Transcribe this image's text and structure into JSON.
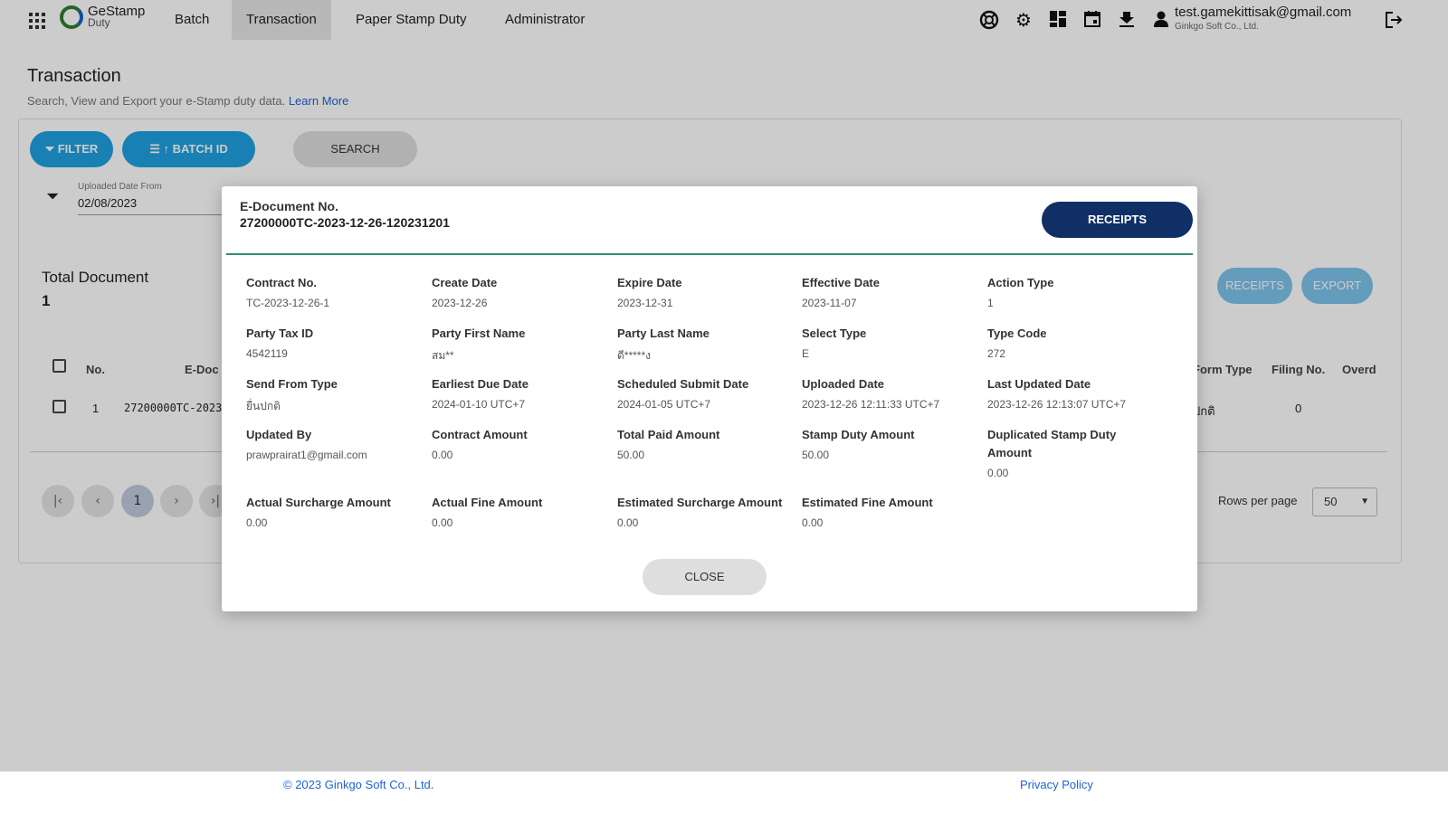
{
  "nav": {
    "logo_line1": "GeStamp",
    "logo_line2": "Duty",
    "items": [
      "Batch",
      "Transaction",
      "Paper Stamp Duty",
      "Administrator"
    ],
    "user_email": "test.gamekittisak@gmail.com",
    "user_company": "Ginkgo Soft Co., Ltd."
  },
  "page": {
    "title": "Transaction",
    "subtitle": "Search, View and Export your e-Stamp duty data.",
    "learn_more": "Learn More"
  },
  "toolbar": {
    "filter_label": "FILTER",
    "batch_id_label": "BATCH ID",
    "search_label": "SEARCH"
  },
  "filters": {
    "uploaded_from_label": "Uploaded Date From",
    "uploaded_from_value": "02/08/2023"
  },
  "summary": {
    "total_label": "Total Document",
    "total_value": "1",
    "receipts_label": "RECEIPTS",
    "export_label": "EXPORT"
  },
  "table": {
    "headers": {
      "no": "No.",
      "edoc": "E-Doc",
      "form_type": "Form Type",
      "filing_no": "Filing No.",
      "overdue": "Overd"
    },
    "row": {
      "no": "1",
      "edoc": "27200000TC-2023",
      "form_type": "ปกติ",
      "filing_no": "0"
    }
  },
  "pager": {
    "current_page": "1",
    "rows_per_page_label": "Rows per page",
    "rows_per_page_value": "50"
  },
  "footer": {
    "copyright": "© 2023 Ginkgo Soft Co., Ltd.",
    "privacy": "Privacy Policy"
  },
  "modal": {
    "edoc_label": "E-Document No.",
    "edoc_value": "27200000TC-2023-12-26-120231201",
    "receipts_label": "RECEIPTS",
    "close_label": "CLOSE",
    "details": [
      {
        "label": "Contract No.",
        "value": "TC-2023-12-26-1"
      },
      {
        "label": "Create Date",
        "value": "2023-12-26"
      },
      {
        "label": "Expire Date",
        "value": "2023-12-31"
      },
      {
        "label": "Effective Date",
        "value": "2023-11-07"
      },
      {
        "label": "Action Type",
        "value": "1"
      },
      {
        "label": "Party Tax ID",
        "value": "4542119"
      },
      {
        "label": "Party First Name",
        "value": "สม**"
      },
      {
        "label": "Party Last Name",
        "value": "ดี*****ง"
      },
      {
        "label": "Select Type",
        "value": "E"
      },
      {
        "label": "Type Code",
        "value": "272"
      },
      {
        "label": "Send From Type",
        "value": "ยื่นปกติ"
      },
      {
        "label": "Earliest Due Date",
        "value": "2024-01-10 UTC+7"
      },
      {
        "label": "Scheduled Submit Date",
        "value": "2024-01-05 UTC+7"
      },
      {
        "label": "Uploaded Date",
        "value": "2023-12-26 12:11:33 UTC+7"
      },
      {
        "label": "Last Updated Date",
        "value": "2023-12-26 12:13:07 UTC+7"
      },
      {
        "label": "Updated By",
        "value": "prawprairat1@gmail.com"
      },
      {
        "label": "Contract Amount",
        "value": "0.00"
      },
      {
        "label": "Total Paid Amount",
        "value": "50.00"
      },
      {
        "label": "Stamp Duty Amount",
        "value": "50.00"
      },
      {
        "label": "Duplicated Stamp Duty Amount",
        "value": "0.00"
      },
      {
        "label": "Actual Surcharge Amount",
        "value": "0.00"
      },
      {
        "label": "Actual Fine Amount",
        "value": "0.00"
      },
      {
        "label": "Estimated Surcharge Amount",
        "value": "0.00"
      },
      {
        "label": "Estimated Fine Amount",
        "value": "0.00"
      }
    ]
  }
}
